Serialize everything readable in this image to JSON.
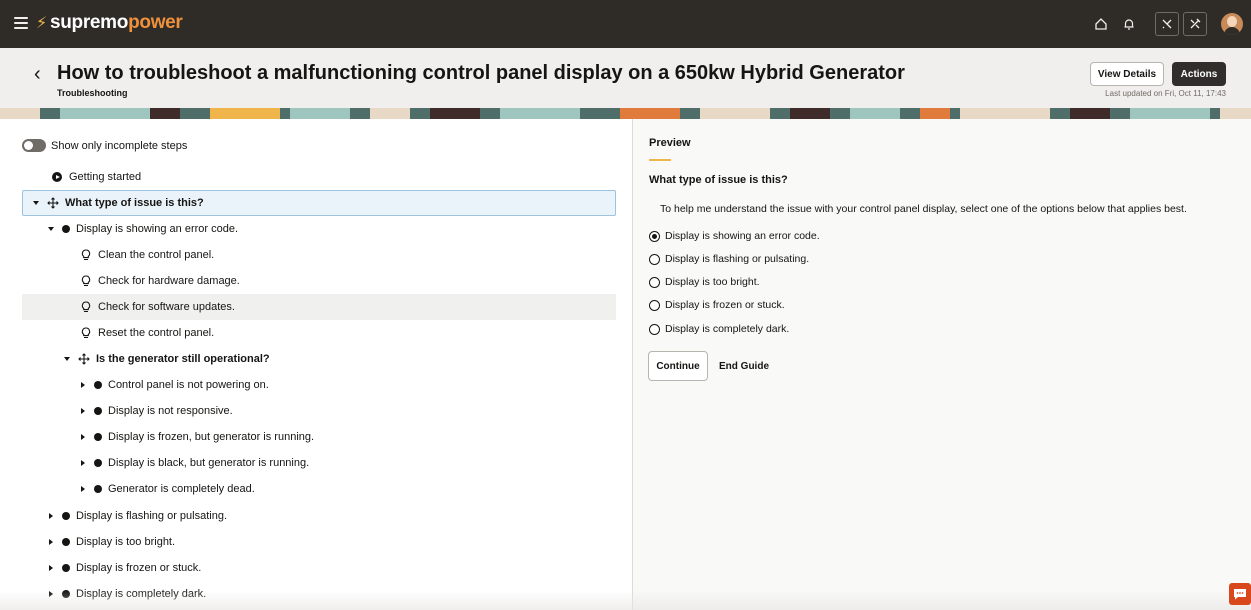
{
  "app": {
    "brand_part1": "supremo",
    "brand_part2": "power"
  },
  "header": {
    "title": "How to troubleshoot a malfunctioning control panel display on a 650kw Hybrid Generator",
    "subtitle": "Troubleshooting",
    "view_details_label": "View Details",
    "actions_label": "Actions",
    "last_updated": "Last updated on Fri, Oct 11, 17:43"
  },
  "tree": {
    "toggle_label": "Show only incomplete steps",
    "items": [
      {
        "label": "Getting started"
      },
      {
        "label": "What type of issue is this?"
      },
      {
        "label": "Display is showing an error code."
      },
      {
        "label": "Clean the control panel."
      },
      {
        "label": "Check for hardware damage."
      },
      {
        "label": "Check for software updates."
      },
      {
        "label": "Reset the control panel."
      },
      {
        "label": "Is the generator still operational?"
      },
      {
        "label": "Control panel is not powering on."
      },
      {
        "label": "Display is not responsive."
      },
      {
        "label": "Display is frozen, but generator is running."
      },
      {
        "label": "Display is black, but generator is running."
      },
      {
        "label": "Generator is completely dead."
      },
      {
        "label": "Display is flashing or pulsating."
      },
      {
        "label": "Display is too bright."
      },
      {
        "label": "Display is frozen or stuck."
      },
      {
        "label": "Display is completely dark."
      }
    ]
  },
  "preview": {
    "label": "Preview",
    "question": "What type of issue is this?",
    "description": "To help me understand the issue with your control panel display, select one of the options below that applies best.",
    "options": [
      {
        "label": "Display is showing an error code.",
        "selected": true
      },
      {
        "label": "Display is flashing or pulsating.",
        "selected": false
      },
      {
        "label": "Display is too bright.",
        "selected": false
      },
      {
        "label": "Display is frozen or stuck.",
        "selected": false
      },
      {
        "label": "Display is completely dark.",
        "selected": false
      }
    ],
    "continue_label": "Continue",
    "end_label": "End Guide"
  },
  "colors": {
    "topbar": "#2f2c28",
    "brand_accent": "#f0913c",
    "selection": "#eaf3fa",
    "chat_button": "#d9481c"
  },
  "icons": {
    "menu": "hamburger-menu-icon",
    "home": "home-icon",
    "notifications": "bell-icon",
    "tool_a": "wrench-cross-icon",
    "tool_b": "tools-icon",
    "chat": "chat-icon"
  }
}
